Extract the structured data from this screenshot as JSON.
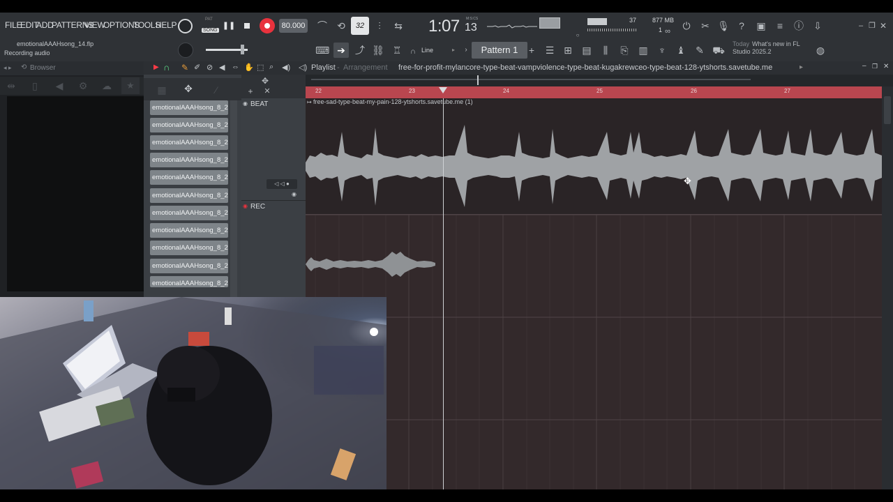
{
  "menu": [
    "FILE",
    "EDIT",
    "ADD",
    "PATTERNS",
    "VIEW",
    "OPTIONS",
    "TOOLS",
    "HELP"
  ],
  "transport": {
    "pat_label": "PAT",
    "song_label": "SONG",
    "tempo": "80.000",
    "time_main": "1:07",
    "time_sub": "13",
    "time_unit": "M:S:CS",
    "step": "32",
    "cpu": "37",
    "memory": "877 MB",
    "voices": "1"
  },
  "project": {
    "file": "emotionalAAAHsong_14.flp",
    "status": "Recording audio"
  },
  "toolbar": {
    "snap": "Line",
    "pattern": "Pattern 1",
    "news_day": "Today",
    "news_text": "What's new in FL Studio 2025.2"
  },
  "browser": {
    "title": "Browser"
  },
  "channels": [
    "emotionalAAAHsong_8_2...",
    "emotionalAAAHsong_8_2...",
    "emotionalAAAHsong_8_2...",
    "emotionalAAAHsong_8_2...",
    "emotionalAAAHsong_8_2...",
    "emotionalAAAHsong_8_2...",
    "emotionalAAAHsong_8_2...",
    "emotionalAAAHsong_8_2...",
    "emotionalAAAHsong_8_2...",
    "emotionalAAAHsong_8_2...",
    "emotionalAAAHsong_8_2..."
  ],
  "playlist": {
    "title": "Playlist",
    "mode": "Arrangement",
    "arrangement_name": "free-for-profit-mylancore-type-beat-vampviolence-type-beat-kugakrewceo-type-beat-128-ytshorts.savetube.me",
    "ruler": [
      "22",
      "23",
      "24",
      "25",
      "26",
      "27"
    ],
    "tracks": [
      {
        "name": "BEAT"
      },
      {
        "name": "REC"
      }
    ],
    "clip_name": "free-sad-type-beat-my-pain-128-ytshorts.savetube.me (1)"
  },
  "colors": {
    "ruler": "#b9464f",
    "clip_bg": "#2a2426",
    "waveform": "#9fa2a5",
    "record": "#e8323d",
    "tempo_box": "#5e6268"
  }
}
